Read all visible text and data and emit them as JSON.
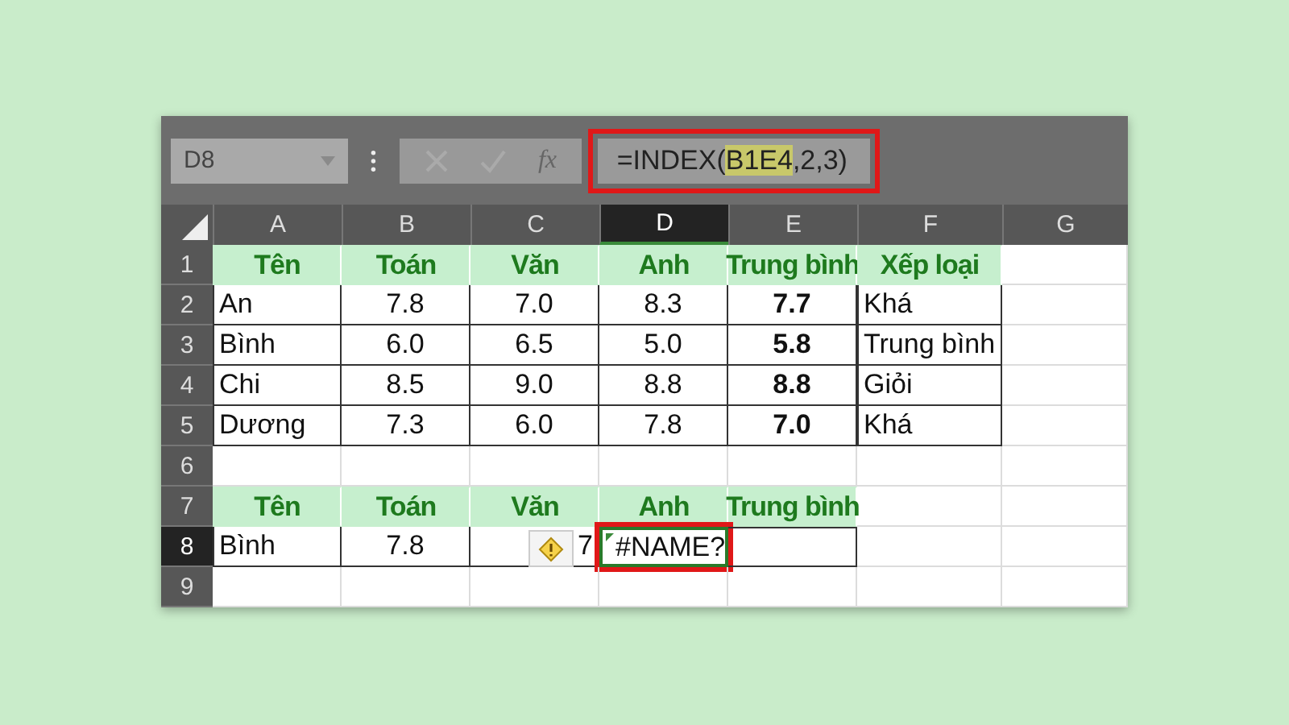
{
  "name_box": "D8",
  "formula_bar": {
    "function_label": "fx",
    "formula": {
      "before": "=INDEX(",
      "reference": "B1E4",
      "after": ",2,3)"
    },
    "highlighted": true
  },
  "columns": [
    {
      "label": "A",
      "selected": false
    },
    {
      "label": "B",
      "selected": false
    },
    {
      "label": "C",
      "selected": false
    },
    {
      "label": "D",
      "selected": true
    },
    {
      "label": "E",
      "selected": false
    },
    {
      "label": "F",
      "selected": false
    },
    {
      "label": "G",
      "selected": false
    }
  ],
  "rows": [
    {
      "label": "1",
      "selected": false,
      "cells": [
        {
          "text": "Tên",
          "kind": "header"
        },
        {
          "text": "Toán",
          "kind": "header"
        },
        {
          "text": "Văn",
          "kind": "header"
        },
        {
          "text": "Anh",
          "kind": "header"
        },
        {
          "text": "Trung bình",
          "kind": "header"
        },
        {
          "text": "Xếp loại",
          "kind": "header"
        },
        {
          "kind": "empty"
        }
      ]
    },
    {
      "label": "2",
      "selected": false,
      "cells": [
        {
          "text": "An",
          "kind": "text"
        },
        {
          "text": "7.8",
          "kind": "number"
        },
        {
          "text": "7.0",
          "kind": "number"
        },
        {
          "text": "8.3",
          "kind": "number"
        },
        {
          "text": "7.7",
          "kind": "bold"
        },
        {
          "text": "Khá",
          "kind": "text"
        },
        {
          "kind": "empty"
        }
      ]
    },
    {
      "label": "3",
      "selected": false,
      "cells": [
        {
          "text": "Bình",
          "kind": "text"
        },
        {
          "text": "6.0",
          "kind": "number"
        },
        {
          "text": "6.5",
          "kind": "number"
        },
        {
          "text": "5.0",
          "kind": "number"
        },
        {
          "text": "5.8",
          "kind": "bold"
        },
        {
          "text": "Trung bình",
          "kind": "text"
        },
        {
          "kind": "empty"
        }
      ]
    },
    {
      "label": "4",
      "selected": false,
      "cells": [
        {
          "text": "Chi",
          "kind": "text"
        },
        {
          "text": "8.5",
          "kind": "number"
        },
        {
          "text": "9.0",
          "kind": "number"
        },
        {
          "text": "8.8",
          "kind": "number"
        },
        {
          "text": "8.8",
          "kind": "bold"
        },
        {
          "text": "Giỏi",
          "kind": "text"
        },
        {
          "kind": "empty"
        }
      ]
    },
    {
      "label": "5",
      "selected": false,
      "cells": [
        {
          "text": "Dương",
          "kind": "text"
        },
        {
          "text": "7.3",
          "kind": "number"
        },
        {
          "text": "6.0",
          "kind": "number"
        },
        {
          "text": "7.8",
          "kind": "number"
        },
        {
          "text": "7.0",
          "kind": "bold"
        },
        {
          "text": "Khá",
          "kind": "text"
        },
        {
          "kind": "empty"
        }
      ]
    },
    {
      "label": "6",
      "selected": false,
      "cells": [
        {
          "kind": "empty"
        },
        {
          "kind": "empty"
        },
        {
          "kind": "empty"
        },
        {
          "kind": "empty"
        },
        {
          "kind": "empty"
        },
        {
          "kind": "empty"
        },
        {
          "kind": "empty"
        }
      ]
    },
    {
      "label": "7",
      "selected": false,
      "cells": [
        {
          "text": "Tên",
          "kind": "header"
        },
        {
          "text": "Toán",
          "kind": "header"
        },
        {
          "text": "Văn",
          "kind": "header"
        },
        {
          "text": "Anh",
          "kind": "header"
        },
        {
          "text": "Trung bình",
          "kind": "header"
        },
        {
          "kind": "empty"
        },
        {
          "kind": "empty"
        }
      ]
    },
    {
      "label": "8",
      "selected": true,
      "cells": [
        {
          "text": "Bình",
          "kind": "text"
        },
        {
          "text": "7.8",
          "kind": "number"
        },
        {
          "text": "7",
          "kind": "covered"
        },
        {
          "text": "#NAME?",
          "kind": "error",
          "highlighted": true
        },
        {
          "text": "",
          "kind": "boxed"
        },
        {
          "kind": "empty"
        },
        {
          "kind": "empty"
        }
      ]
    },
    {
      "label": "9",
      "selected": false,
      "cells": [
        {
          "kind": "empty"
        },
        {
          "kind": "empty"
        },
        {
          "kind": "empty"
        },
        {
          "kind": "empty"
        },
        {
          "kind": "empty"
        },
        {
          "kind": "empty"
        },
        {
          "kind": "empty"
        }
      ]
    }
  ]
}
